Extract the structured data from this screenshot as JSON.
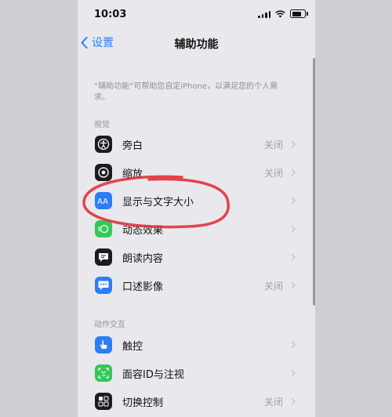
{
  "status": {
    "time": "10:03"
  },
  "nav": {
    "back_label": "设置",
    "title": "辅助功能"
  },
  "description": "“辅助功能”可帮助您自定iPhone，以满足您的个人需求。",
  "sections": [
    {
      "header": "视觉",
      "items": [
        {
          "label": "旁白",
          "value": "关闭",
          "icon": "voiceover-icon",
          "color": "#1c1c1e"
        },
        {
          "label": "缩放",
          "value": "关闭",
          "icon": "zoom-icon",
          "color": "#1c1c1e"
        },
        {
          "label": "显示与文字大小",
          "value": "",
          "icon": "text-size-icon",
          "color": "#2f7cf6"
        },
        {
          "label": "动态效果",
          "value": "",
          "icon": "motion-icon",
          "color": "#34c759"
        },
        {
          "label": "朗读内容",
          "value": "",
          "icon": "speech-icon",
          "color": "#1c1c1e"
        },
        {
          "label": "口述影像",
          "value": "关闭",
          "icon": "audio-description-icon",
          "color": "#2f7cf6"
        }
      ]
    },
    {
      "header": "动作交互",
      "items": [
        {
          "label": "触控",
          "value": "",
          "icon": "touch-icon",
          "color": "#2f7cf6"
        },
        {
          "label": "面容ID与注视",
          "value": "",
          "icon": "face-id-icon",
          "color": "#34c759"
        },
        {
          "label": "切换控制",
          "value": "关闭",
          "icon": "switch-control-icon",
          "color": "#1c1c1e"
        }
      ]
    }
  ],
  "annotation_color": "#e2323a"
}
